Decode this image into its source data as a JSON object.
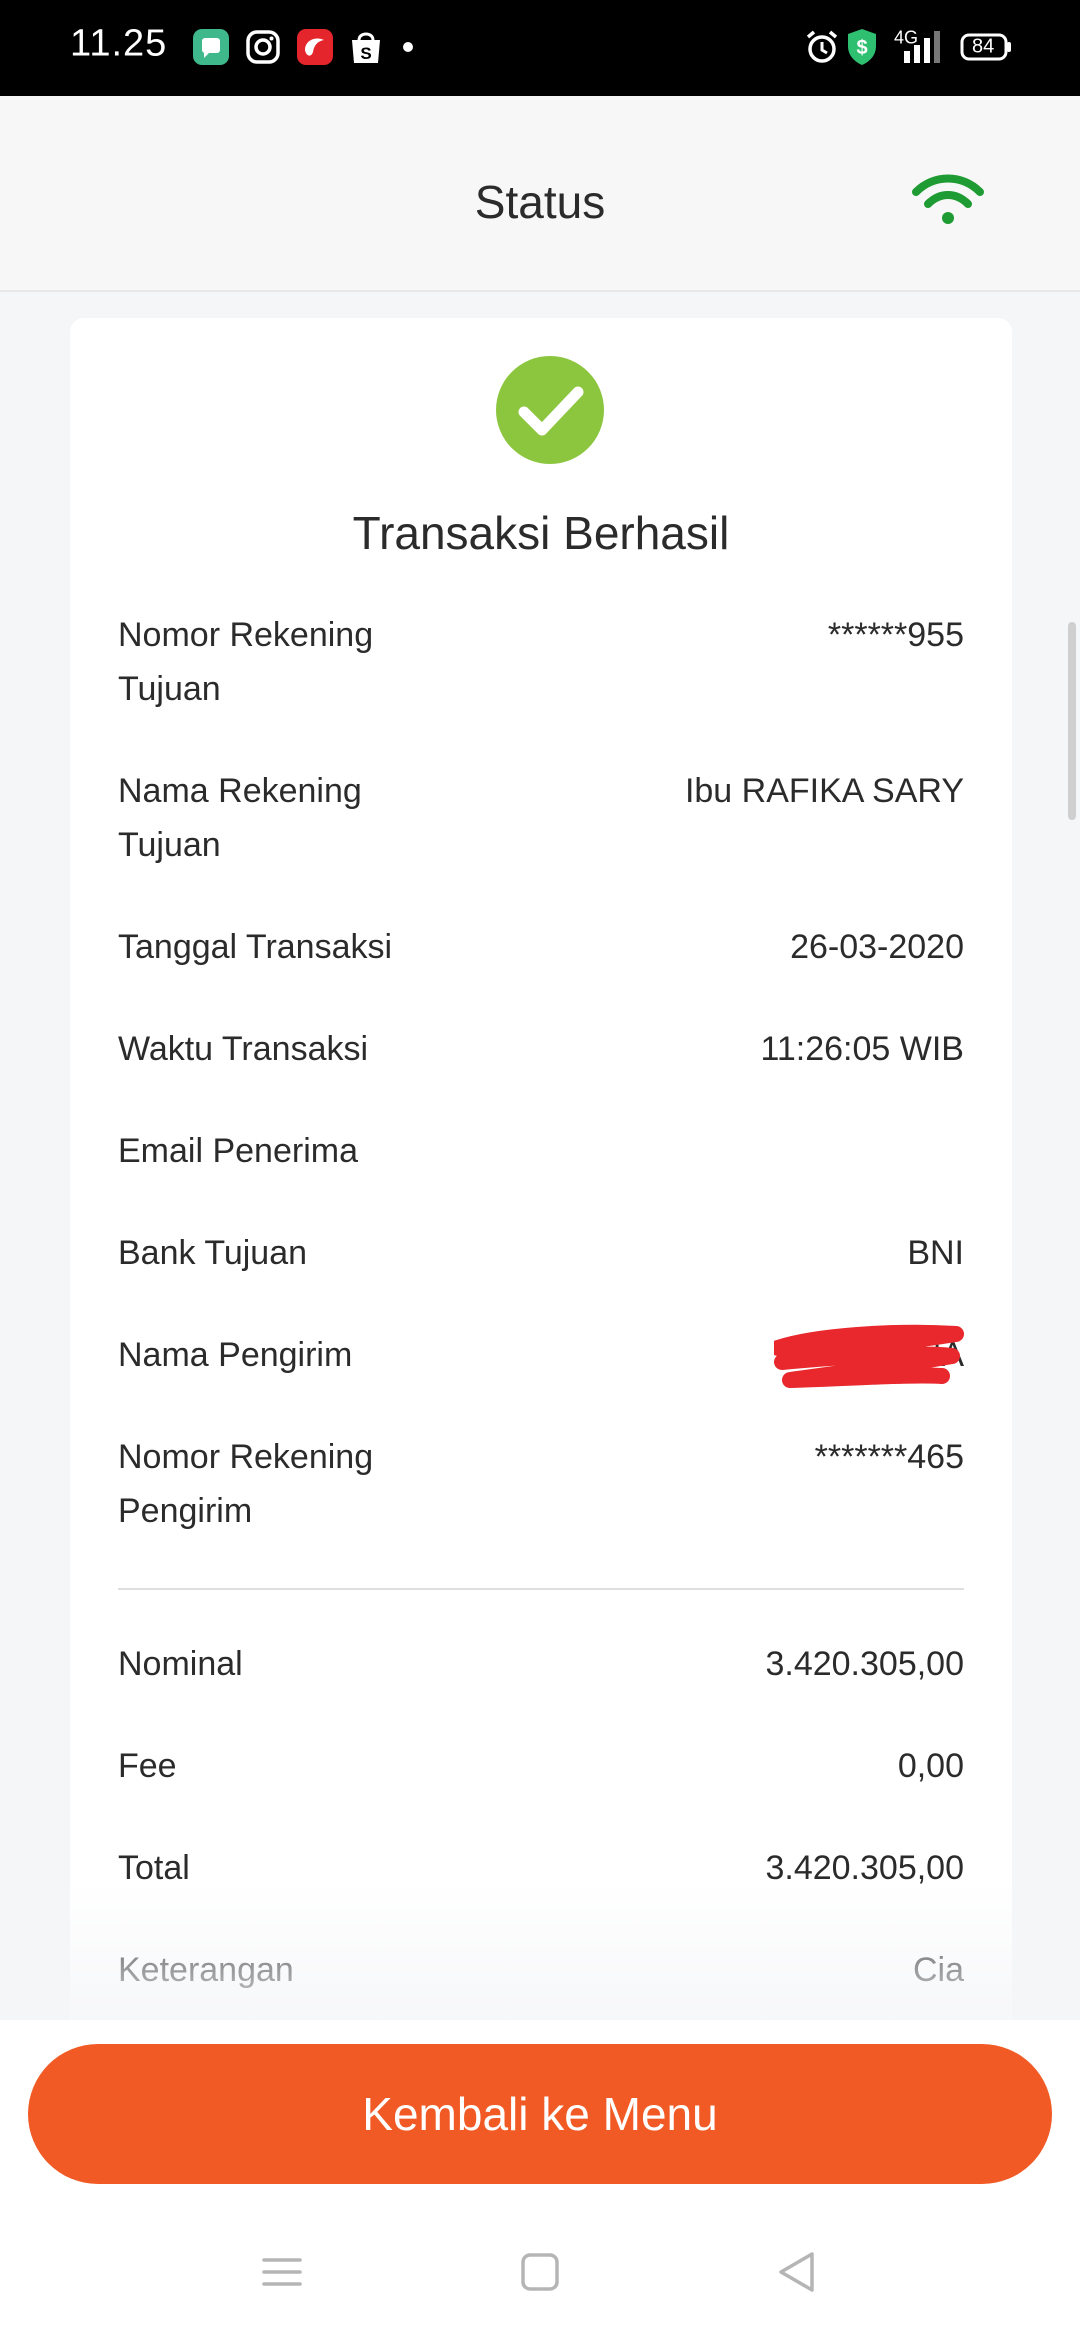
{
  "status_bar": {
    "time": "11.25",
    "network": "4G",
    "battery": "84",
    "icons": [
      "chat-icon",
      "instagram-icon",
      "telkomsel-icon",
      "shopee-icon",
      "notification-dot",
      "alarm-icon",
      "security-shield-icon",
      "signal-icon",
      "battery-icon"
    ]
  },
  "header": {
    "title": "Status",
    "connection_icon": "wifi-icon",
    "accent_color": "#1e9b32"
  },
  "card": {
    "status_icon": "check-circle-icon",
    "status_color": "#8cc63f",
    "title": "Transaksi Berhasil",
    "details": [
      {
        "label": "Nomor Rekening Tujuan",
        "value": "******955"
      },
      {
        "label": "Nama Rekening Tujuan",
        "value": "Ibu RAFIKA SARY"
      },
      {
        "label": "Tanggal Transaksi",
        "value": "26-03-2020"
      },
      {
        "label": "Waktu Transaksi",
        "value": "11:26:05 WIB"
      },
      {
        "label": "Email Penerima",
        "value": ""
      },
      {
        "label": "Bank Tujuan",
        "value": "BNI"
      },
      {
        "label": "Nama Pengirim",
        "value": "NA"
      },
      {
        "label": "Nomor Rekening Pengirim",
        "value": "*******465"
      }
    ],
    "amounts": [
      {
        "label": "Nominal",
        "value": "3.420.305,00"
      },
      {
        "label": "Fee",
        "value": "0,00"
      },
      {
        "label": "Total",
        "value": "3.420.305,00"
      },
      {
        "label": "Keterangan",
        "value": "Cia"
      }
    ]
  },
  "actions": {
    "back_to_menu": "Kembali ke Menu",
    "button_color": "#f15a24"
  },
  "nav_bar": {
    "items": [
      "menu-icon",
      "home-icon",
      "back-icon"
    ]
  }
}
